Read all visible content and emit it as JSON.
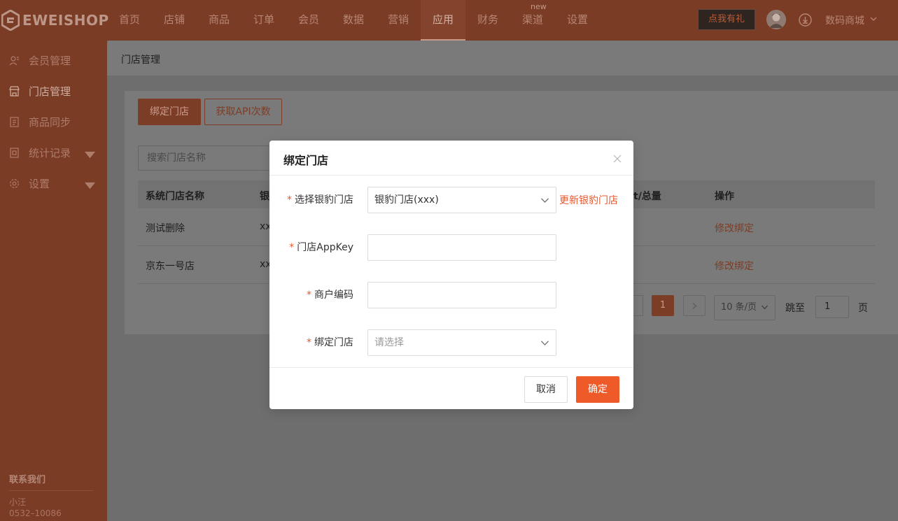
{
  "brand": {
    "logo_text": "EWEISHOP"
  },
  "nav": {
    "items": [
      {
        "label": "首页"
      },
      {
        "label": "店铺"
      },
      {
        "label": "商品"
      },
      {
        "label": "订单"
      },
      {
        "label": "会员"
      },
      {
        "label": "数据"
      },
      {
        "label": "营销"
      },
      {
        "label": "应用"
      },
      {
        "label": "财务"
      },
      {
        "label": "渠道"
      },
      {
        "label": "设置"
      }
    ],
    "active_index": 7,
    "badge": "new",
    "gift_button": "点我有礼",
    "shop_name": "数码商城"
  },
  "sidebar": {
    "items": [
      {
        "label": "会员管理",
        "icon": "user-icon"
      },
      {
        "label": "门店管理",
        "icon": "store-icon"
      },
      {
        "label": "商品同步",
        "icon": "document-icon"
      },
      {
        "label": "统计记录",
        "icon": "record-icon"
      },
      {
        "label": "设置",
        "icon": "gear-icon"
      }
    ],
    "contact_title": "联系我们",
    "contact_name": "小汪",
    "contact_phone": "0532–10086"
  },
  "page": {
    "breadcrumb": "门店管理",
    "bind_store_button": "绑定门店",
    "api_button": "获取API次数",
    "search_placeholder": "搜索门店名称",
    "table": {
      "headers": [
        "系统门店名称",
        "银",
        "t/总量",
        "操作"
      ],
      "rows": [
        {
          "name": "测试删除",
          "col2": "xx",
          "action": "修改绑定"
        },
        {
          "name": "京东一号店",
          "col2": "xx",
          "action": "修改绑定"
        }
      ]
    },
    "pagination": {
      "current_page": "1",
      "page_size": "10 条/页",
      "jump_label": "跳至",
      "jump_value": "1",
      "page_unit": "页"
    }
  },
  "modal": {
    "title": "绑定门店",
    "fields": [
      {
        "label": "选择银豹门店",
        "value": "银豹门店(xxx)"
      },
      {
        "label": "门店AppKey",
        "value": ""
      },
      {
        "label": "商户编码",
        "value": ""
      },
      {
        "label": "绑定门店",
        "placeholder": "请选择"
      }
    ],
    "required_mark": "*",
    "refresh_link": "更新银豹门店",
    "cancel_button": "取消",
    "confirm_button": "确定"
  },
  "colors": {
    "accent": "#ee5a28",
    "topbar_dimmed": "#7a3c25"
  }
}
